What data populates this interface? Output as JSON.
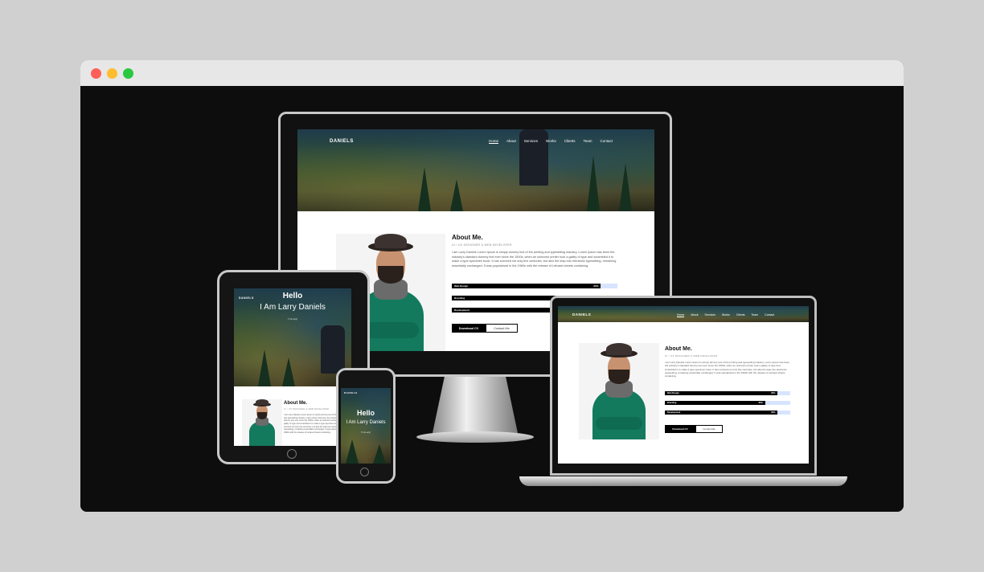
{
  "window": {
    "controls": [
      "close",
      "minimize",
      "zoom"
    ]
  },
  "site": {
    "brand": "DANIELS",
    "nav": [
      "Home",
      "About",
      "Services",
      "Works",
      "Clients",
      "Team",
      "Contact"
    ],
    "hero": {
      "hello": "Hello",
      "iam": "I Am Larry Daniels",
      "social_icons": "f  t  in  ◂  ◎"
    },
    "about": {
      "title": "About Me.",
      "subtitle": "UI / UX DESIGNER & WEB DEVELOPER",
      "text": "I am Larry Daniels Lorem Ipsum is simply dummy text of the printing and typesetting industry. Lorem Ipsum has been the industry's standard dummy text ever since the 1500s, when an unknown printer took a galley of type and scrambled it to make a type specimen book. It has survived not only five centuries, but also the leap into electronic typesetting, remaining essentially unchanged. It was popularised in the 1960s with the release of Letraset sheets containing.",
      "skills": [
        {
          "label": "Web Design",
          "value": "90%",
          "fraction": 0.9
        },
        {
          "label": "Branding",
          "value": "80%",
          "fraction": 0.8
        },
        {
          "label": "Development",
          "value": "90%",
          "fraction": 0.9
        }
      ],
      "download_label": "Download CV",
      "contact_label": "Contact Me"
    }
  }
}
